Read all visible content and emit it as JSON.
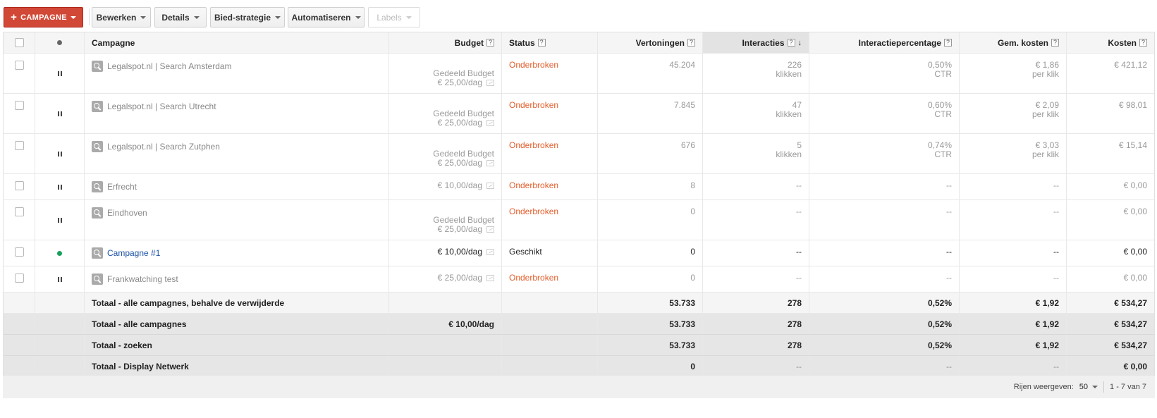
{
  "toolbar": {
    "campaign_label": "CAMPAGNE",
    "buttons": [
      {
        "label": "Bewerken"
      },
      {
        "label": "Details"
      },
      {
        "label": "Bied-strategie"
      },
      {
        "label": "Automatiseren"
      },
      {
        "label": "Labels",
        "disabled": true
      }
    ]
  },
  "table": {
    "headers": {
      "campaign": "Campagne",
      "budget": "Budget",
      "status": "Status",
      "impressions": "Vertoningen",
      "interactions": "Interacties",
      "interaction_rate": "Interactiepercentage",
      "avg_cost": "Gem. kosten",
      "cost": "Kosten",
      "help": "?",
      "sort_arrow": "↓"
    },
    "rows": [
      {
        "name": "Legalspot.nl | Search Amsterdam",
        "budget1": "Gedeeld Budget",
        "budget2": "€ 25,00/dag",
        "status": "Onderbroken",
        "impressions": "45.204",
        "interactions": "226",
        "interactions_unit": "klikken",
        "rate": "0,50%",
        "rate_unit": "CTR",
        "avg_cost": "€ 1,86",
        "avg_cost_unit": "per klik",
        "cost": "€ 421,12",
        "active": false
      },
      {
        "name": "Legalspot.nl | Search Utrecht",
        "budget1": "Gedeeld Budget",
        "budget2": "€ 25,00/dag",
        "status": "Onderbroken",
        "impressions": "7.845",
        "interactions": "47",
        "interactions_unit": "klikken",
        "rate": "0,60%",
        "rate_unit": "CTR",
        "avg_cost": "€ 2,09",
        "avg_cost_unit": "per klik",
        "cost": "€ 98,01",
        "active": false
      },
      {
        "name": "Legalspot.nl | Search Zutphen",
        "budget1": "Gedeeld Budget",
        "budget2": "€ 25,00/dag",
        "status": "Onderbroken",
        "impressions": "676",
        "interactions": "5",
        "interactions_unit": "klikken",
        "rate": "0,74%",
        "rate_unit": "CTR",
        "avg_cost": "€ 3,03",
        "avg_cost_unit": "per klik",
        "cost": "€ 15,14",
        "active": false
      },
      {
        "name": "Erfrecht",
        "budget1": "",
        "budget2": "€ 10,00/dag",
        "status": "Onderbroken",
        "impressions": "8",
        "interactions": "--",
        "interactions_unit": "",
        "rate": "--",
        "rate_unit": "",
        "avg_cost": "--",
        "avg_cost_unit": "",
        "cost": "€ 0,00",
        "active": false
      },
      {
        "name": "Eindhoven",
        "budget1": "Gedeeld Budget",
        "budget2": "€ 25,00/dag",
        "status": "Onderbroken",
        "impressions": "0",
        "interactions": "--",
        "interactions_unit": "",
        "rate": "--",
        "rate_unit": "",
        "avg_cost": "--",
        "avg_cost_unit": "",
        "cost": "€ 0,00",
        "active": false
      },
      {
        "name": "Campagne #1",
        "budget1": "",
        "budget2": "€ 10,00/dag",
        "status": "Geschikt",
        "impressions": "0",
        "interactions": "--",
        "interactions_unit": "",
        "rate": "--",
        "rate_unit": "",
        "avg_cost": "--",
        "avg_cost_unit": "",
        "cost": "€ 0,00",
        "active": true
      },
      {
        "name": "Frankwatching test",
        "budget1": "",
        "budget2": "€ 25,00/dag",
        "status": "Onderbroken",
        "impressions": "0",
        "interactions": "--",
        "interactions_unit": "",
        "rate": "--",
        "rate_unit": "",
        "avg_cost": "--",
        "avg_cost_unit": "",
        "cost": "€ 0,00",
        "active": false
      }
    ],
    "totals": [
      {
        "label": "Totaal - alle campagnes, behalve de verwijderde",
        "budget": "",
        "impressions": "53.733",
        "interactions": "278",
        "rate": "0,52%",
        "avg_cost": "€ 1,92",
        "cost": "€ 534,27"
      },
      {
        "label": "Totaal - alle campagnes",
        "budget": "€ 10,00/dag",
        "impressions": "53.733",
        "interactions": "278",
        "rate": "0,52%",
        "avg_cost": "€ 1,92",
        "cost": "€ 534,27"
      },
      {
        "label": "Totaal - zoeken",
        "budget": "",
        "impressions": "53.733",
        "interactions": "278",
        "rate": "0,52%",
        "avg_cost": "€ 1,92",
        "cost": "€ 534,27"
      },
      {
        "label": "Totaal - Display Netwerk",
        "budget": "",
        "impressions": "0",
        "interactions": "--",
        "rate": "--",
        "avg_cost": "--",
        "cost": "€ 0,00"
      }
    ]
  },
  "footer": {
    "rows_label": "Rijen weergeven:",
    "rows_value": "50",
    "range": "1 - 7 van 7"
  }
}
